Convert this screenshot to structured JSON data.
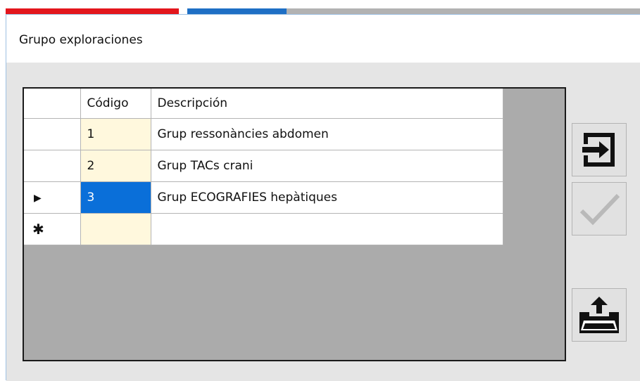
{
  "window": {
    "title": "Grupo exploraciones"
  },
  "grid": {
    "columns": [
      "Código",
      "Descripción"
    ],
    "rows": [
      {
        "code": "1",
        "description": "Grup ressonàncies abdomen",
        "current": false
      },
      {
        "code": "2",
        "description": "Grup TACs crani",
        "current": false
      },
      {
        "code": "3",
        "description": "Grup ECOGRAFIES hepàtiques",
        "current": true
      }
    ],
    "current_row_marker": "▶",
    "new_row_marker": "✱"
  },
  "toolbar": {
    "exit_icon": "exit-arrow-icon",
    "accept_icon": "checkmark-icon",
    "upload_icon": "upload-folder-icon"
  },
  "colors": {
    "stripe_red": "#e3161d",
    "stripe_blue": "#1e6fc5",
    "selection": "#0a6fd9",
    "code_cell": "#fff8dd",
    "grid_background": "#ababab"
  }
}
